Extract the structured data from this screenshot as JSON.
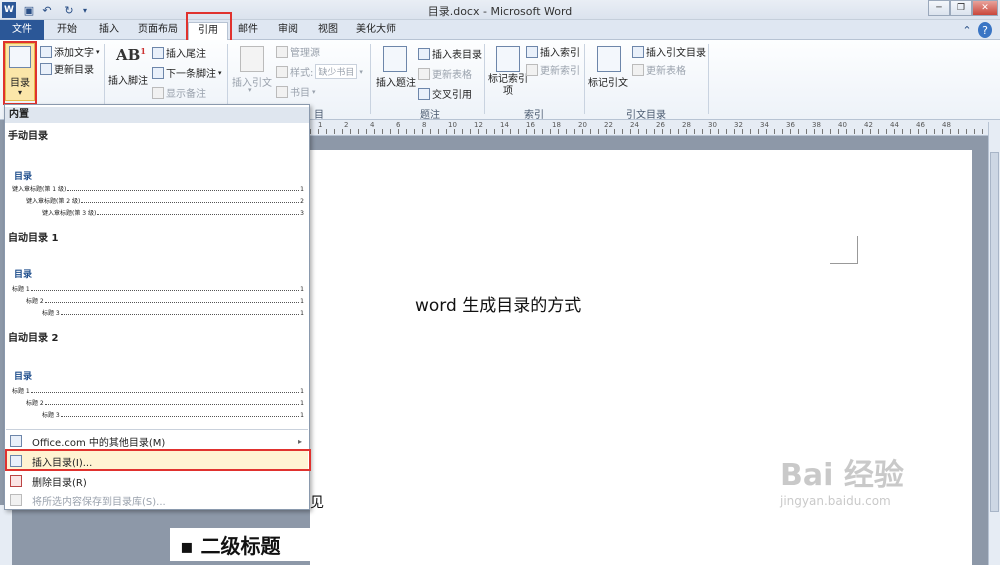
{
  "window": {
    "title": "目录.docx - Microsoft Word"
  },
  "tabs": [
    "文件",
    "开始",
    "插入",
    "页面布局",
    "引用",
    "邮件",
    "审阅",
    "视图",
    "美化大师"
  ],
  "ribbon": {
    "toc": {
      "label": "目录",
      "add_text": "添加文字",
      "update_toc": "更新目录"
    },
    "footnotes": {
      "insert_footnote": "插入脚注",
      "insert_endnote": "插入尾注",
      "next_footnote": "下一条脚注",
      "show_notes": "显示备注"
    },
    "citations": {
      "insert_citation": "插入引文",
      "manage_sources": "管理源",
      "style_label": "样式:",
      "style_value": "缺少书目",
      "bibliography": "书目",
      "group_fragment": "目"
    },
    "captions": {
      "insert_caption": "插入题注",
      "insert_table_of_figures": "插入表目录",
      "update_table": "更新表格",
      "cross_reference": "交叉引用",
      "group": "题注"
    },
    "index": {
      "mark_entry": "标记索引项",
      "insert_index": "插入索引",
      "update_index": "更新索引",
      "group": "索引"
    },
    "authorities": {
      "mark_citation": "标记引文",
      "insert_toa": "插入引文目录",
      "update_table": "更新表格",
      "group": "引文目录"
    }
  },
  "ruler": {
    "ticks": [
      "1",
      "2",
      "4",
      "6",
      "8",
      "10",
      "12",
      "14",
      "16",
      "18",
      "20",
      "22",
      "24",
      "26",
      "28",
      "30",
      "32",
      "34",
      "36",
      "38",
      "40",
      "42",
      "44",
      "46",
      "48"
    ]
  },
  "dropdown": {
    "builtin_header": "内置",
    "manual_title": "手动目录",
    "manual_preview": {
      "heading": "目录",
      "lines": [
        "键入章标题(第 1 级)",
        "键入章标题(第 2 级)",
        "键入章标题(第 3 级)"
      ],
      "pages": [
        "1",
        "2",
        "3"
      ]
    },
    "auto1_title": "自动目录 1",
    "auto1_preview": {
      "heading": "目录",
      "lines": [
        "标题 1",
        "标题 2",
        "标题 3"
      ],
      "pages": [
        "1",
        "1",
        "1"
      ]
    },
    "auto2_title": "自动目录 2",
    "auto2_preview": {
      "heading": "目录",
      "lines": [
        "标题 1",
        "标题 2",
        "标题 3"
      ],
      "pages": [
        "1",
        "1",
        "1"
      ]
    },
    "items": {
      "office_more": "Office.com 中的其他目录(M)",
      "insert_toc": "插入目录(I)...",
      "remove_toc": "删除目录(R)",
      "save_selection": "将所选内容保存到目录库(S)..."
    }
  },
  "document": {
    "title": "word 生成目录的方式",
    "fragment": "见",
    "heading2": "二级标题"
  },
  "watermark": {
    "brand": "Bai 经验",
    "url": "jingyan.baidu.com"
  }
}
